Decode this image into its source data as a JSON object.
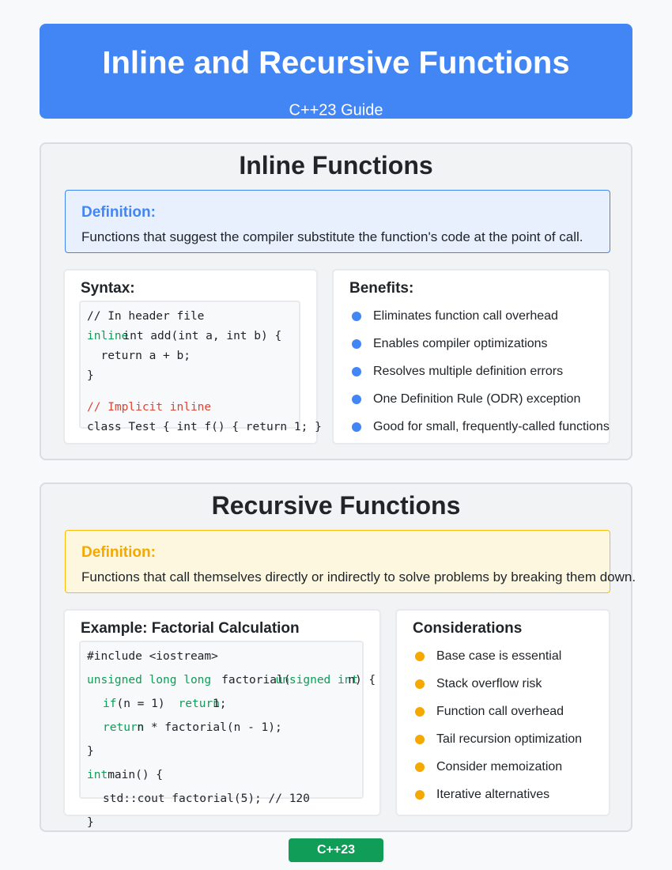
{
  "header": {
    "title": "Inline and Recursive Functions",
    "subtitle": "C++23 Guide"
  },
  "colors": {
    "header_blue": "#4285f4",
    "accent_yellow": "#fbbc04",
    "keyword_green": "#0f9d58",
    "comment_red": "#db4437"
  },
  "inline": {
    "title": "Inline Functions",
    "definition_label": "Definition:",
    "definition_text": "Functions that suggest the compiler substitute the function's code at the point of call.",
    "syntax_title": "Syntax:",
    "code": {
      "line1": "// In header file",
      "line2_kw": "inline",
      "line2_rest": "int add(int a, int b) {",
      "line3": "  return a + b;",
      "line4": "}",
      "line5": "// Implicit inline",
      "line6": "class Test { int f() { return 1; }"
    },
    "benefits_title": "Benefits:",
    "benefits": [
      "Eliminates function call overhead",
      "Enables compiler optimizations",
      "Resolves multiple definition errors",
      "One Definition Rule (ODR) exception",
      "Good for small, frequently-called functions"
    ]
  },
  "recursive": {
    "title": "Recursive Functions",
    "definition_label": "Definition:",
    "definition_text": "Functions that call themselves directly or indirectly to solve problems by breaking them down.",
    "example_title": "Example: Factorial Calculation",
    "code": {
      "line1": "#include <iostream>",
      "line2_kw1": "unsigned long long",
      "line2_mid": "factorial(",
      "line2_kw2": "unsigned int",
      "line2_end": "n) {",
      "line3_kw1": "if",
      "line3_mid": "(n = 1)",
      "line3_kw2": "return",
      "line3_end": "1;",
      "line4_kw": "return",
      "line4_rest": "n * factorial(n - 1);",
      "line5": "}",
      "line6_kw": "int",
      "line6_rest": "main() {",
      "line7": "std::cout factorial(5); // 120",
      "line8": "}"
    },
    "considerations_title": "Considerations",
    "considerations": [
      "Base case is essential",
      "Stack overflow risk",
      "Function call overhead",
      "Tail recursion optimization",
      "Consider memoization",
      "Iterative alternatives"
    ]
  },
  "footer": {
    "badge": "C++23"
  }
}
